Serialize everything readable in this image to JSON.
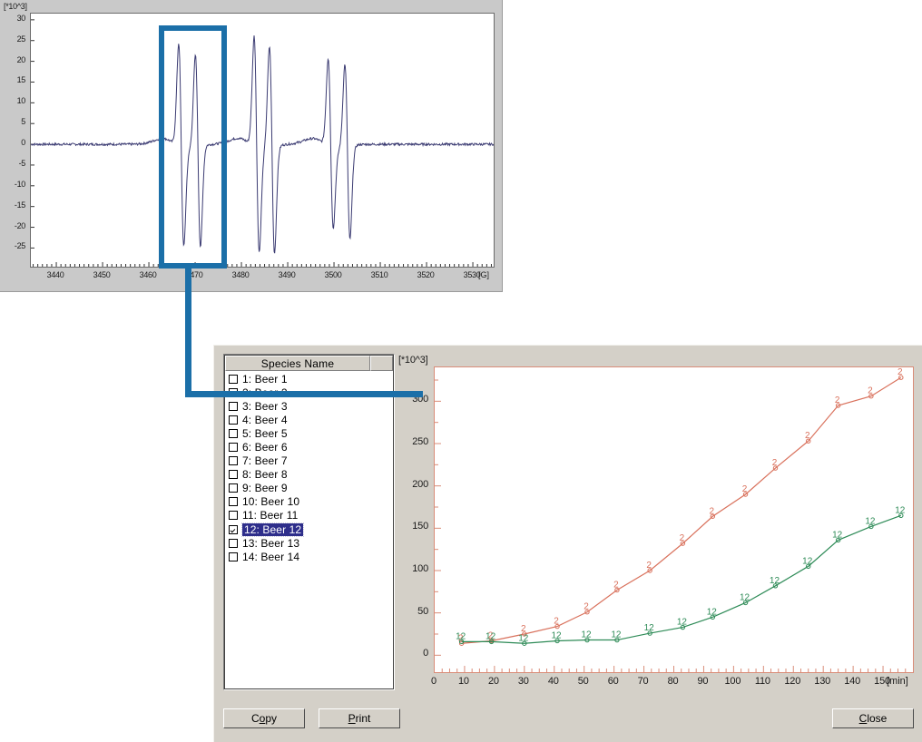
{
  "epr_panel": {
    "name": "epr-spectrum",
    "y_unit": "[*10^3]",
    "x_unit": "[G]",
    "y_ticks": [
      "30",
      "25",
      "20",
      "15",
      "10",
      "5",
      "0",
      "-5",
      "-10",
      "-15",
      "-20",
      "-25"
    ],
    "x_ticks": [
      "3440",
      "3450",
      "3460",
      "3470",
      "3480",
      "3490",
      "3500",
      "3510",
      "3520",
      "3530"
    ],
    "trace_color": "#3b3b72",
    "callout_color": "#1b6fa8"
  },
  "dialog": {
    "list": {
      "header_label": "Species Name",
      "items": [
        {
          "index": "1",
          "label": "1:  Beer 1",
          "checked": false,
          "selected": false
        },
        {
          "index": "2",
          "label": "2:  Beer 2",
          "checked": true,
          "selected": false
        },
        {
          "index": "3",
          "label": "3:  Beer 3",
          "checked": false,
          "selected": false
        },
        {
          "index": "4",
          "label": "4:  Beer 4",
          "checked": false,
          "selected": false
        },
        {
          "index": "5",
          "label": "5:  Beer 5",
          "checked": false,
          "selected": false
        },
        {
          "index": "6",
          "label": "6:  Beer 6",
          "checked": false,
          "selected": false
        },
        {
          "index": "7",
          "label": "7:  Beer 7",
          "checked": false,
          "selected": false
        },
        {
          "index": "8",
          "label": "8:  Beer 8",
          "checked": false,
          "selected": false
        },
        {
          "index": "9",
          "label": "9:  Beer 9",
          "checked": false,
          "selected": false
        },
        {
          "index": "10",
          "label": "10:  Beer 10",
          "checked": false,
          "selected": false
        },
        {
          "index": "11",
          "label": "11:  Beer 11",
          "checked": false,
          "selected": false
        },
        {
          "index": "12",
          "label": "12:  Beer 12",
          "checked": true,
          "selected": true
        },
        {
          "index": "13",
          "label": "13:  Beer 13",
          "checked": false,
          "selected": false
        },
        {
          "index": "14",
          "label": "14:  Beer 14",
          "checked": false,
          "selected": false
        }
      ]
    },
    "buttons": {
      "copy": {
        "pre": "C",
        "accel": "o",
        "post": "py"
      },
      "print": {
        "pre": "",
        "accel": "P",
        "post": "rint"
      },
      "close": {
        "pre": "",
        "accel": "C",
        "post": "lose"
      }
    }
  },
  "chart_data": {
    "type": "line",
    "title": "",
    "xlabel": "[min]",
    "ylabel": "[*10^3]",
    "xlim": [
      0,
      160
    ],
    "ylim": [
      -20,
      340
    ],
    "grid": false,
    "legend": "inline-point-labels",
    "x_ticks": [
      "0",
      "10",
      "20",
      "30",
      "40",
      "50",
      "60",
      "70",
      "80",
      "90",
      "100",
      "110",
      "120",
      "130",
      "140",
      "150"
    ],
    "y_ticks": [
      "0",
      "50",
      "100",
      "150",
      "200",
      "250",
      "300"
    ],
    "x_minor_step": 2.5,
    "y_minor_step": 25,
    "series": [
      {
        "name": "2",
        "label": "Beer 2",
        "color": "#d9715c",
        "point_label": "2",
        "x": [
          9,
          19,
          30,
          41,
          51,
          61,
          72,
          83,
          93,
          104,
          114,
          125,
          135,
          146,
          156
        ],
        "y": [
          14,
          17,
          25,
          34,
          51,
          77,
          100,
          132,
          164,
          190,
          221,
          253,
          295,
          306,
          328
        ]
      },
      {
        "name": "12",
        "label": "Beer 12",
        "color": "#2e8b57",
        "point_label": "12",
        "x": [
          9,
          19,
          30,
          41,
          51,
          61,
          72,
          83,
          93,
          104,
          114,
          125,
          135,
          146,
          156
        ],
        "y": [
          16,
          16,
          14,
          17,
          18,
          18,
          26,
          33,
          45,
          62,
          82,
          105,
          136,
          152,
          165
        ]
      }
    ]
  }
}
